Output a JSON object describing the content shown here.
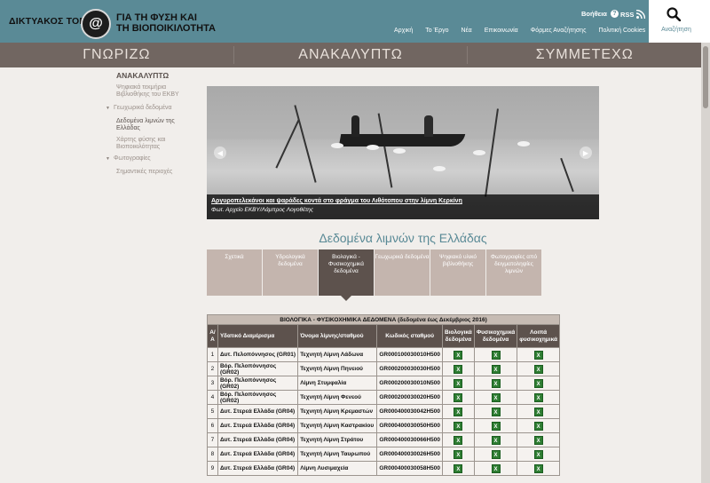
{
  "header": {
    "logo_left": "ΔΙΚΤΥΑΚΟΣ ΤΟΠΟΣ",
    "logo_mark": "@",
    "logo_right_line1": "ΓΙΑ ΤΗ ΦΥΣΗ ΚΑΙ",
    "logo_right_line2": "ΤΗ ΒΙΟΠΟΙΚΙΛΟΤΗΤΑ",
    "help_label": "Βοήθεια",
    "rss_label": "RSS",
    "nav": [
      "Αρχική",
      "Το Έργο",
      "Νέα",
      "Επικοινωνία",
      "Φόρμες Αναζήτησης",
      "Πολιτική Cookies"
    ],
    "search_label": "Αναζήτηση"
  },
  "mainnav": [
    "ΓΝΩΡΙΖΩ",
    "ΑΝΑΚΑΛΥΠΤΩ",
    "ΣΥΜΜΕΤΕΧΩ"
  ],
  "sidebar": {
    "title": "ΑΝΑΚΑΛΥΠΤΩ",
    "items": [
      {
        "label": "Ψηφιακά τεκμήρια Βιβλιοθήκης του ΕΚΒΥ",
        "type": "child"
      },
      {
        "label": "Γεωχωρικά δεδομένα",
        "type": "parent"
      },
      {
        "label": "Δεδομένα λιμνών της Ελλάδας",
        "type": "active"
      },
      {
        "label": "Χάρτης φύσης και Βιοποικιλότητας",
        "type": "child"
      },
      {
        "label": "Φωτογραφίες",
        "type": "parent"
      },
      {
        "label": "Σημαντικές περιοχές",
        "type": "child"
      }
    ]
  },
  "hero": {
    "caption_title": "Αργυροπελεκάνοι και ψαράδες κοντά στο φράγμα του Λιθότοπου στην λίμνη Κερκίνη",
    "caption_credit": "Φωτ. Αρχείο ΕΚΒΥ/Λάμπρος Λογοθέτης"
  },
  "section_title": "Δεδομένα λιμνών της Ελλάδας",
  "tabs": [
    {
      "label": "Σχετικά",
      "active": false
    },
    {
      "label": "Υδρολογικά δεδομένα",
      "active": false
    },
    {
      "label": "Βιολογικά - Φυσικοχημικά δεδομένα",
      "active": true
    },
    {
      "label": "Γεωχωρικά δεδομένα",
      "active": false
    },
    {
      "label": "Ψηφιακό υλικό βιβλιοθήκης",
      "active": false
    },
    {
      "label": "Φωτογραφίες από δειγματοληψίες λιμνών",
      "active": false
    }
  ],
  "table": {
    "caption": "ΒΙΟΛΟΓΙΚΑ - ΦΥΣΙΚΟΧΗΜΙΚΑ ΔΕΔΟΜΕΝΑ (δεδομένα έως Δεκέμβριος 2016)",
    "headers": [
      "Α/Α",
      "Υδατικό Διαμέρισμα",
      "Όνομα λίμνης/σταθμού",
      "Κωδικός σταθμού",
      "Βιολογικά δεδομένα",
      "Φυσικοχημικά δεδομένα",
      "Λοιπά φυσικοχημικά"
    ],
    "rows": [
      [
        "1",
        "Δυτ. Πελοπόννησος (GR01)",
        "Τεχνητή Λίμνη Λάδωνα",
        "GR000100030010H500"
      ],
      [
        "2",
        "Βόρ. Πελοπόννησος (GR02)",
        "Τεχνητή Λίμνη Πηνειού",
        "GR000200030030H500"
      ],
      [
        "3",
        "Βόρ. Πελοπόννησος (GR02)",
        "Λίμνη Στυμφαλία",
        "GR000200030010N500"
      ],
      [
        "4",
        "Βόρ. Πελοπόννησος (GR02)",
        "Τεχνητή Λίμνη Φενεού",
        "GR000200030020H500"
      ],
      [
        "5",
        "Δυτ. Στερεά Ελλάδα (GR04)",
        "Τεχνητή Λίμνη Κρεμαστών",
        "GR000400030042H500"
      ],
      [
        "6",
        "Δυτ. Στερεά Ελλάδα (GR04)",
        "Τεχνητή Λίμνη Καστρακίου",
        "GR000400030050H500"
      ],
      [
        "7",
        "Δυτ. Στερεά Ελλάδα (GR04)",
        "Τεχνητή Λίμνη Στράτου",
        "GR000400030066H500"
      ],
      [
        "8",
        "Δυτ. Στερεά Ελλάδα (GR04)",
        "Τεχνητή Λίμνη Ταυρωπού",
        "GR000400030026H500"
      ],
      [
        "9",
        "Δυτ. Στερεά Ελλάδα (GR04)",
        "Λίμνη Λυσιμαχεία",
        "GR000400030058H500"
      ]
    ],
    "xls_icon": "excel-file-icon"
  }
}
